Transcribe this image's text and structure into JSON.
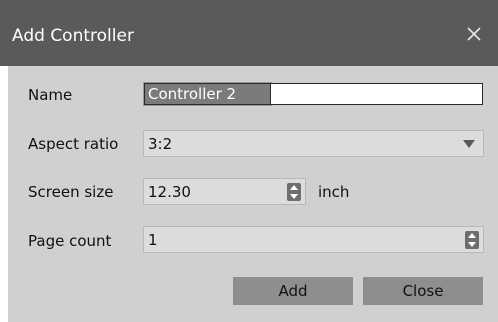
{
  "dialog": {
    "title": "Add Controller",
    "close_icon": "close-icon"
  },
  "form": {
    "name": {
      "label": "Name",
      "value": "Controller 2"
    },
    "aspect_ratio": {
      "label": "Aspect ratio",
      "selected": "3:2"
    },
    "screen_size": {
      "label": "Screen size",
      "value": "12.30",
      "unit": "inch"
    },
    "page_count": {
      "label": "Page count",
      "value": "1"
    }
  },
  "buttons": {
    "add": "Add",
    "close": "Close"
  },
  "colors": {
    "titlebar": "#5a5a5a",
    "body": "#d0d0d0",
    "button": "#8e8e8e",
    "selected_text_bg": "#7b7b7b"
  }
}
